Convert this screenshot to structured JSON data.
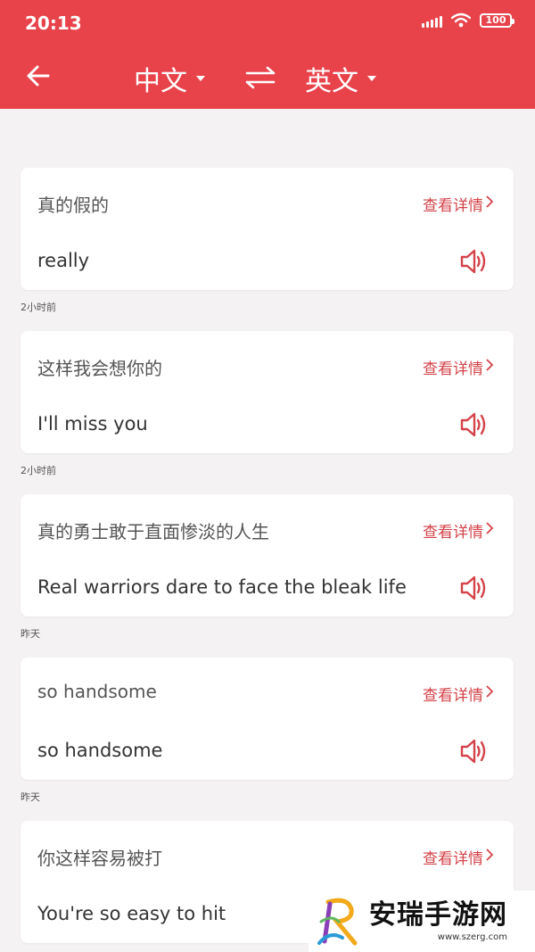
{
  "status_bar": {
    "time": "20:13",
    "battery": "100"
  },
  "nav": {
    "from_lang": "中文",
    "to_lang": "英文"
  },
  "colors": {
    "accent": "#e8434b",
    "link": "#d4434a",
    "background": "#f4f2f3"
  },
  "history": [
    {
      "source": "真的假的",
      "detail_label": "查看详情",
      "translation": "really",
      "time_label": "2小时前"
    },
    {
      "source": "这样我会想你的",
      "detail_label": "查看详情",
      "translation": "I'll miss you",
      "time_label": "2小时前"
    },
    {
      "source": "真的勇士敢于直面惨淡的人生",
      "detail_label": "查看详情",
      "translation": "Real warriors dare to face the bleak life",
      "time_label": "昨天"
    },
    {
      "source": "so handsome",
      "detail_label": "查看详情",
      "translation": "so handsome",
      "time_label": "昨天"
    },
    {
      "source": "你这样容易被打",
      "detail_label": "查看详情",
      "translation": "You're so easy to hit",
      "time_label": ""
    }
  ],
  "watermark": {
    "title": "安瑞手游网",
    "url": "www.szerg.com"
  }
}
